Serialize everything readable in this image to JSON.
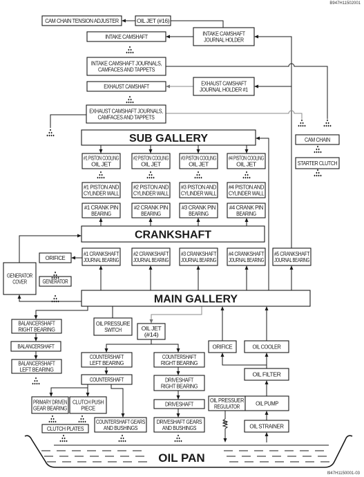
{
  "figure_code_top": "B947H11502001",
  "figure_code_bottom": "I947H1150001-03",
  "boxes": {
    "cam_chain_tension_adjuster": [
      "CAM CHAIN TENSION ADJUSTER"
    ],
    "oil_jet_16": [
      "OIL JET (#16)"
    ],
    "intake_camshaft_journal_holder": [
      "INTAKE CAMSHAFT",
      "JOURNAL HOLDER"
    ],
    "intake_camshaft": [
      "INTAKE CAMSHAFT"
    ],
    "intake_camshaft_journals": [
      "INTAKE CAMSHAFT JOURNALS,",
      "CAMFACES AND TAPPETS"
    ],
    "exhaust_camshaft": [
      "EXHAUST CAMSHAFT"
    ],
    "exhaust_camshaft_journal_holder": [
      "EXHAUST CAMSHAFT",
      "JOURNAL HOLDER #1"
    ],
    "exhaust_camshaft_journals": [
      "EXHAUST CAMSHAFT JOURNALS,",
      "CAMFACES AND TAPPETS"
    ],
    "sub_gallery": [
      "SUB GALLERY"
    ],
    "cam_chain": [
      "CAM CHAIN"
    ],
    "starter_clutch": [
      "STARTER CLUTCH"
    ],
    "piston_jet_1": [
      "#1 PISTON COOLING",
      "OIL JET"
    ],
    "piston_jet_2": [
      "#2 PISTON COOLING",
      "OIL JET"
    ],
    "piston_jet_3": [
      "#3 PISTON COOLING",
      "OIL JET"
    ],
    "piston_jet_4": [
      "#4 PISTON COOLING",
      "OIL JET"
    ],
    "piston_wall_1": [
      "#1 PISTON AND",
      "CYLINDER WALL"
    ],
    "piston_wall_2": [
      "#2 PISTON AND",
      "CYLINDER WALL"
    ],
    "piston_wall_3": [
      "#3 PISTON AND",
      "CYLINDER WALL"
    ],
    "piston_wall_4": [
      "#4 PISTON AND",
      "CYLINDER WALL"
    ],
    "crank_pin_1": [
      "#1 CRANK PIN",
      "BEARING"
    ],
    "crank_pin_2": [
      "#2 CRANK PIN",
      "BEARING"
    ],
    "crank_pin_3": [
      "#3 CRANK PIN",
      "BEARING"
    ],
    "crank_pin_4": [
      "#4 CRANK PIN",
      "BEARING"
    ],
    "crankshaft": [
      "CRANKSHAFT"
    ],
    "journal_1": [
      "#1 CRANKSHAFT",
      "JOURNAL BEARING"
    ],
    "journal_2": [
      "#2 CRANKSHAFT",
      "JOURNAL BEARING"
    ],
    "journal_3": [
      "#3 CRANKSHAFT",
      "JOURNAL BEARING"
    ],
    "journal_4": [
      "#4 CRANKSHAFT",
      "JOURNAL BEARING"
    ],
    "journal_5": [
      "#5 CRANKSHAFT",
      "JOURNAL BEARING"
    ],
    "orifice_upper": [
      "ORIFICE"
    ],
    "generator_cover": [
      "GENERATOR",
      "COVER"
    ],
    "generator": [
      "GENERATOR"
    ],
    "main_gallery": [
      "MAIN GALLERY"
    ],
    "balancershaft_right_bearing": [
      "BALANCERSHAFT",
      "RIGHT BEARING"
    ],
    "balancershaft": [
      "BALANCERSHAFT"
    ],
    "balancershaft_left_bearing": [
      "BALANCERSHAFT",
      "LEFT BEARING"
    ],
    "oil_pressure_switch": [
      "OIL PRESSURE",
      "SWITCH"
    ],
    "oil_jet_14": [
      "OIL JET",
      "(#14)"
    ],
    "countershaft_left_bearing": [
      "COUNTERSHAFT",
      "LEFT BEARING"
    ],
    "countershaft": [
      "COUNTERSHAFT"
    ],
    "countershaft_right_bearing": [
      "COUNTERSHAFT",
      "RIGHT BEARING"
    ],
    "driveshaft_right_bearing": [
      "DRIVESHAFT",
      "RIGHT BEARING"
    ],
    "driveshaft": [
      "DRIVESHAFT"
    ],
    "primary_driven_gear_bearing": [
      "PRIMARY DRIVEN",
      "GEAR BEARING"
    ],
    "clutch_push_piece": [
      "CLUTCH PUSH",
      "PIECE"
    ],
    "clutch_plates": [
      "CLUTCH PLATES"
    ],
    "countershaft_gears": [
      "COUNTERSHAFT GEARS",
      "AND BUSHINGS"
    ],
    "driveshaft_gears": [
      "DRIVESHAFT GEARS",
      "AND BUSHINGS"
    ],
    "orifice_lower": [
      "ORIFICE"
    ],
    "oil_cooler": [
      "OIL COOLER"
    ],
    "oil_filter": [
      "OIL FILTER"
    ],
    "oil_pressure_regulator": [
      "OIL PRESSUER",
      "REGULATOR"
    ],
    "oil_pump": [
      "OIL PUMP"
    ],
    "oil_strainer": [
      "OIL STRAINER"
    ]
  },
  "oil_pan": "OIL PAN"
}
